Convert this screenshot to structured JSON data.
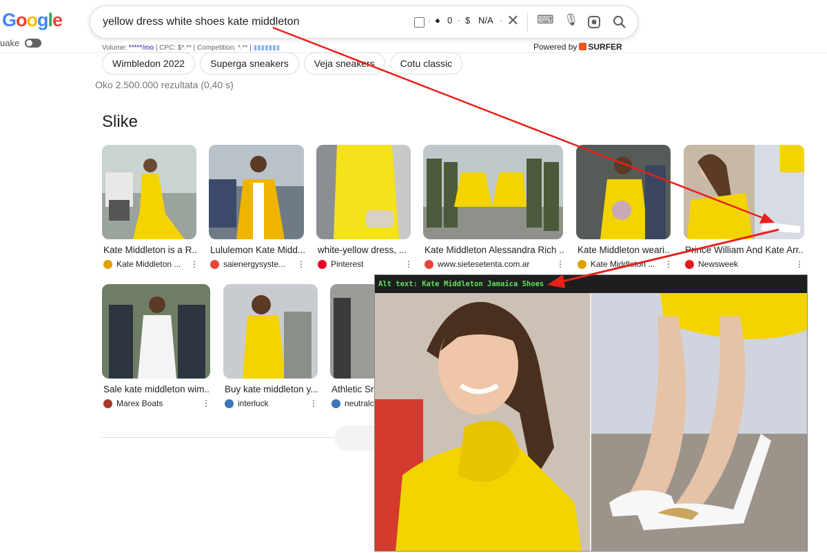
{
  "logo": {
    "letters": [
      "G",
      "o",
      "o",
      "g",
      "l",
      "e"
    ],
    "colors": [
      "#4285F4",
      "#EA4335",
      "#FBBC05",
      "#4285F4",
      "#34A853",
      "#EA4335"
    ]
  },
  "sidebar": {
    "quake_label": "uake"
  },
  "search": {
    "query": "yellow dress white shoes kate middleton",
    "coins": "0",
    "price": "N/A"
  },
  "metrics": {
    "volume_label": "Volume: ",
    "volume_value": "*****/mo",
    "cpc": " | CPC: $*.** | Competition: *.** | "
  },
  "powered_by": {
    "label": "Powered by",
    "brand": "SURFER"
  },
  "chips": [
    "Wimbledon 2022",
    "Superga sneakers",
    "Veja sneakers",
    "Cotu classic"
  ],
  "results_count": "Oko 2.500.000 rezultata (0,40 s)",
  "images_heading": "Slike",
  "images_row1": [
    {
      "title": "Kate Middleton is a R...",
      "source": "Kate Middleton ...",
      "fav": "#e0a100"
    },
    {
      "title": "Lululemon Kate Midd...",
      "source": "saienergysyste...",
      "fav": "#e8453c"
    },
    {
      "title": "white-yellow dress, ...",
      "source": "Pinterest",
      "fav": "#e60023"
    },
    {
      "title": "Kate Middleton Alessandra Rich ...",
      "source": "www.sietesetenta.com.ar",
      "fav": "#e8453c"
    },
    {
      "title": "Kate Middleton weari...",
      "source": "Kate Middleton ...",
      "fav": "#e0a100"
    },
    {
      "title": "Prince William And Kate Arr...",
      "source": "Newsweek",
      "fav": "#e31b23"
    }
  ],
  "images_row2": [
    {
      "title": "Sale kate middleton wim...",
      "source": "Marex Boats",
      "fav": "#a83a2a"
    },
    {
      "title": "Buy kate middleton y...",
      "source": "interluck",
      "fav": "#3a76b8"
    },
    {
      "title": "Athletic Sr",
      "source": "neutralc",
      "fav": "#3a76b8"
    }
  ],
  "overlay": {
    "alt_text": "Alt text: Kate Middleton Jamaica Shoes"
  },
  "colors": {
    "accent_red": "#e8201c",
    "dress_yellow": "#f3d400",
    "surfer_orange": "#e8541d"
  }
}
